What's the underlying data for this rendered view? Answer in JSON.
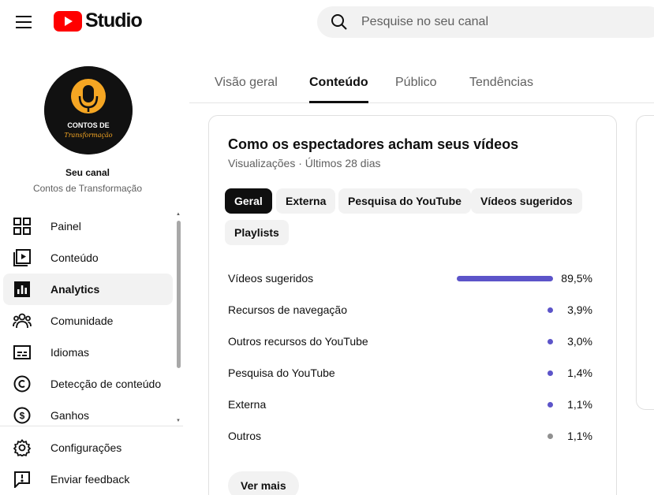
{
  "header": {
    "logo_text": "Studio",
    "search_placeholder": "Pesquise no seu canal"
  },
  "channel": {
    "title": "Seu canal",
    "name": "Contos de Transformação",
    "avatar_text_line1": "CONTOS DE",
    "avatar_text_line2": "Transformação"
  },
  "sidebar": {
    "items": [
      {
        "label": "Painel",
        "icon": "dashboard-icon"
      },
      {
        "label": "Conteúdo",
        "icon": "content-icon"
      },
      {
        "label": "Analytics",
        "icon": "analytics-icon"
      },
      {
        "label": "Comunidade",
        "icon": "community-icon"
      },
      {
        "label": "Idiomas",
        "icon": "subtitles-icon"
      },
      {
        "label": "Detecção de conteúdo",
        "icon": "copyright-icon"
      },
      {
        "label": "Ganhos",
        "icon": "earn-icon"
      }
    ],
    "bottom_items": [
      {
        "label": "Configurações",
        "icon": "settings-icon"
      },
      {
        "label": "Enviar feedback",
        "icon": "feedback-icon"
      }
    ]
  },
  "tabs": [
    {
      "label": "Visão geral"
    },
    {
      "label": "Conteúdo"
    },
    {
      "label": "Público"
    },
    {
      "label": "Tendências"
    }
  ],
  "card": {
    "title": "Como os espectadores acham seus vídeos",
    "subtitle": "Visualizações · Últimos 28 dias",
    "chips": [
      {
        "label": "Geral"
      },
      {
        "label": "Externa"
      },
      {
        "label": "Pesquisa do YouTube"
      },
      {
        "label": "Vídeos sugeridos"
      },
      {
        "label": "Playlists"
      }
    ],
    "sources": [
      {
        "label": "Vídeos sugeridos",
        "value": "89,5%",
        "share": 0.895,
        "color": "#5c54c9"
      },
      {
        "label": "Recursos de navegação",
        "value": "3,9%",
        "share": 0.039,
        "color": "#5c54c9"
      },
      {
        "label": "Outros recursos do YouTube",
        "value": "3,0%",
        "share": 0.03,
        "color": "#5c54c9"
      },
      {
        "label": "Pesquisa do YouTube",
        "value": "1,4%",
        "share": 0.014,
        "color": "#5c54c9"
      },
      {
        "label": "Externa",
        "value": "1,1%",
        "share": 0.011,
        "color": "#5c54c9"
      },
      {
        "label": "Outros",
        "value": "1,1%",
        "share": 0.011,
        "color": "#909090"
      }
    ],
    "see_more": "Ver mais"
  },
  "colors": {
    "brand_red": "#ff0000",
    "accent_purple": "#5c54c9",
    "avatar_orange": "#f5a623"
  }
}
